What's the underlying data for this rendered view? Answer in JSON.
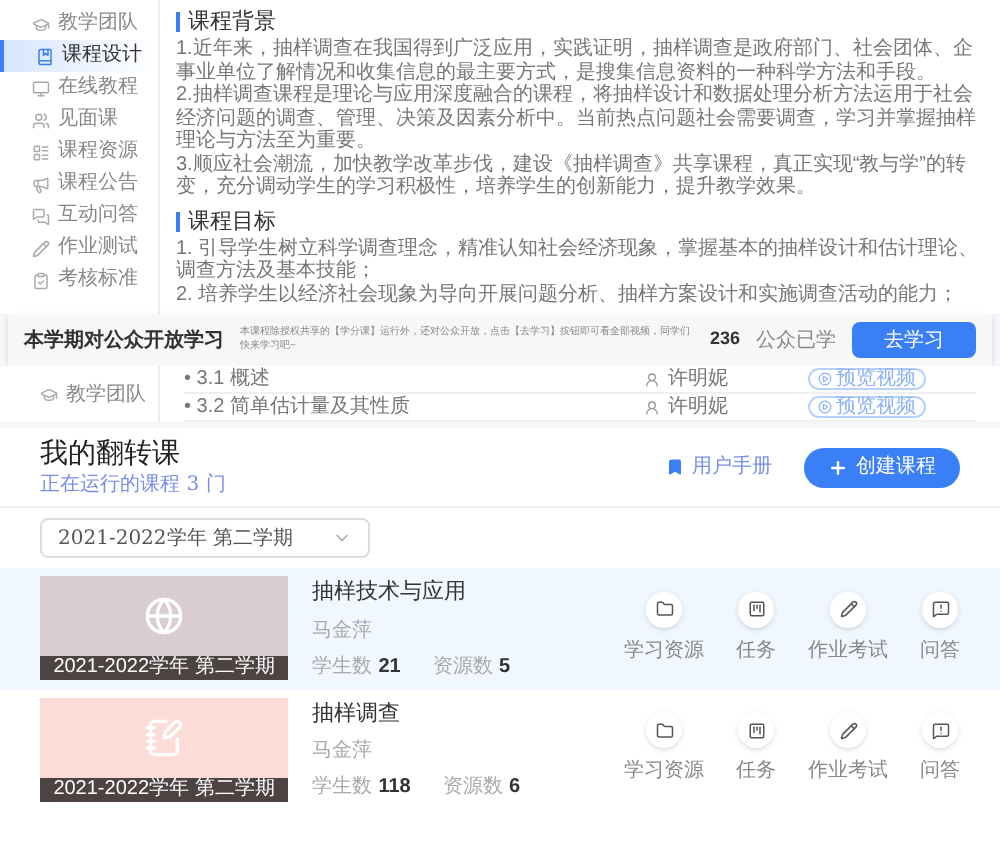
{
  "sidebar": {
    "items": [
      {
        "label": "教学团队",
        "selected": false
      },
      {
        "label": "课程设计",
        "selected": true
      },
      {
        "label": "在线教程",
        "selected": false
      },
      {
        "label": "见面课",
        "selected": false
      },
      {
        "label": "课程资源",
        "selected": false
      },
      {
        "label": "课程公告",
        "selected": false
      },
      {
        "label": "互动问答",
        "selected": false
      },
      {
        "label": "作业测试",
        "selected": false
      },
      {
        "label": "考核标准",
        "selected": false
      }
    ]
  },
  "sections": [
    {
      "title": "课程背景",
      "paragraphs": [
        "1.近年来，抽样调查在我国得到广泛应用，实践证明，抽样调查是政府部门、社会团体、企事业单位了解情况和收集信息的最主要方式，是搜集信息资料的一种科学方法和手段。",
        "2.抽样调查课程是理论与应用深度融合的课程，将抽样设计和数据处理分析方法运用于社会经济问题的调查、管理、决策及因素分析中。当前热点问题社会需要调查，学习并掌握抽样理论与方法至为重要。",
        "3.顺应社会潮流，加快教学改革步伐，建设《抽样调查》共享课程，真正实现“教与学”的转变，充分调动学生的学习积极性，培养学生的创新能力，提升教学效果。"
      ]
    },
    {
      "title": "课程目标",
      "paragraphs": [
        "1. 引导学生树立科学调查理念，精准认知社会经济现象，掌握基本的抽样设计和估计理论、调查方法及基本技能；",
        "2. 培养学生以经济社会现象为导向开展问题分析、抽样方案设计和实施调查活动的能力；"
      ]
    }
  ],
  "banner": {
    "title": "本学期对公众开放学习",
    "text": "本课程除授权共享的【学分课】运行外，还对公众开放，点击【去学习】按钮即可看全部视频，同学们快来学习吧~",
    "count": "236",
    "count_label": "公众已学",
    "button": "去学习"
  },
  "chapter_rows": [
    {
      "sidebar_label": "教学团队",
      "marker": "•",
      "number": "3.1",
      "title": "概述",
      "teacher": "许明妮",
      "button": "预览视频"
    },
    {
      "marker": "•",
      "number": "3.2",
      "title": "简单估计量及其性质",
      "teacher": "许明妮",
      "button": "预览视频"
    }
  ],
  "flip": {
    "title": "我的翻转课",
    "subtitle": "正在运行的课程",
    "count": "3",
    "unit": "门",
    "manual": "用户手册",
    "create": "创建课程",
    "term": "2021-2022学年 第二学期",
    "courses": [
      {
        "title": "抽样技术与应用",
        "teacher": "马金萍",
        "students_label": "学生数",
        "students": "21",
        "resources_label": "资源数",
        "resources": "5",
        "term": "2021-2022学年 第二学期",
        "color": "#d9ccd2",
        "selected": true,
        "actions": [
          {
            "label": "学习资源"
          },
          {
            "label": "任务"
          },
          {
            "label": "作业考试"
          },
          {
            "label": "问答"
          }
        ]
      },
      {
        "title": "抽样调查",
        "teacher": "马金萍",
        "students_label": "学生数",
        "students": "118",
        "resources_label": "资源数",
        "resources": "6",
        "term": "2021-2022学年 第二学期",
        "color": "#fcdcd6",
        "selected": false,
        "actions": [
          {
            "label": "学习资源"
          },
          {
            "label": "任务"
          },
          {
            "label": "作业考试"
          },
          {
            "label": "问答"
          }
        ]
      }
    ]
  }
}
